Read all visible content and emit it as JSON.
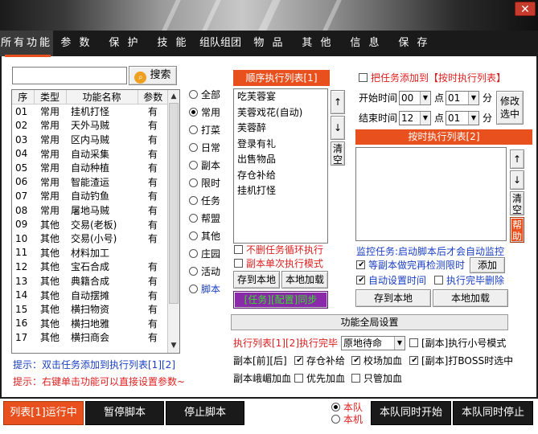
{
  "window": {
    "close_label": "✕"
  },
  "tabs": [
    {
      "label": "所有功能",
      "active": true
    },
    {
      "label": "参 数"
    },
    {
      "label": "保 护"
    },
    {
      "label": "技 能"
    },
    {
      "label": "组队组团"
    },
    {
      "label": "物 品"
    },
    {
      "label": "其 他"
    },
    {
      "label": "信 息"
    },
    {
      "label": "保 存"
    }
  ],
  "search": {
    "value": "",
    "button_label": "搜索",
    "icon": "search-icon"
  },
  "function_table": {
    "headers": [
      "序",
      "类型",
      "功能名称",
      "参数"
    ],
    "rows": [
      [
        "01",
        "常用",
        "挂机打怪",
        "有"
      ],
      [
        "02",
        "常用",
        "天外马贼",
        "有"
      ],
      [
        "03",
        "常用",
        "区内马贼",
        "有"
      ],
      [
        "04",
        "常用",
        "自动采集",
        "有"
      ],
      [
        "05",
        "常用",
        "自动种植",
        "有"
      ],
      [
        "06",
        "常用",
        "智能渣运",
        "有"
      ],
      [
        "07",
        "常用",
        "自动钓鱼",
        "有"
      ],
      [
        "08",
        "常用",
        "屠地马贼",
        "有"
      ],
      [
        "09",
        "其他",
        "交易(老板)",
        "有"
      ],
      [
        "10",
        "其他",
        "交易(小号)",
        "有"
      ],
      [
        "11",
        "其他",
        "材料加工",
        ""
      ],
      [
        "12",
        "其他",
        "宝石合成",
        "有"
      ],
      [
        "13",
        "其他",
        "典籍合成",
        "有"
      ],
      [
        "14",
        "其他",
        "自动摆摊",
        "有"
      ],
      [
        "15",
        "其他",
        "横扫物资",
        "有"
      ],
      [
        "16",
        "其他",
        "横扫地雅",
        "有"
      ],
      [
        "17",
        "其他",
        "横扫商会",
        "有"
      ]
    ]
  },
  "hints": {
    "line1": "提示：双击任务添加到执行列表[1][2]",
    "line2": "提示：右键单击功能可以直接设置参数~"
  },
  "categories": [
    {
      "label": "全部",
      "selected": false
    },
    {
      "label": "常用",
      "selected": true
    },
    {
      "label": "打菜",
      "selected": false
    },
    {
      "label": "日常",
      "selected": false
    },
    {
      "label": "副本",
      "selected": false
    },
    {
      "label": "限时",
      "selected": false
    },
    {
      "label": "任务",
      "selected": false
    },
    {
      "label": "帮盟",
      "selected": false
    },
    {
      "label": "其他",
      "selected": false
    },
    {
      "label": "庄园",
      "selected": false
    },
    {
      "label": "活动",
      "selected": false
    },
    {
      "label": "脚本",
      "selected": false
    }
  ],
  "sequence_list": {
    "title": "顺序执行列表[1]",
    "items": [
      "吃芙蓉宴",
      "芙蓉戏花(自动)",
      "芙蓉醉",
      "登录有礼",
      "出售物品",
      "存仓补给",
      "挂机打怪"
    ],
    "up": "↑",
    "down": "↓",
    "clear": "清空",
    "loop_label": "不删任务循环执行",
    "loop_checked": false,
    "single_label": "副本单次执行模式",
    "single_checked": false,
    "save_local": "存到本地",
    "load_local": "本地加载",
    "sync": "[任务][配置]同步"
  },
  "timed": {
    "add_label": "把任务添加到【按时执行列表】",
    "add_checked": false,
    "start_label": "开始时间",
    "start_hour": "00",
    "start_min": "01",
    "end_label": "结束时间",
    "end_hour": "12",
    "end_min": "01",
    "point": "点",
    "minute": "分",
    "modify_label": "修改选中",
    "list_title": "按时执行列表[2]",
    "up": "↑",
    "down": "↓",
    "clear": "清空",
    "help": "帮助",
    "monitor_text": "监控任务:启动脚本后才会自动监控",
    "wait_label": "等副本做完再检测限时",
    "wait_checked": true,
    "add_btn": "添加",
    "auto_time_label": "自动设置时间",
    "auto_time_checked": true,
    "finish_delete_label": "执行完毕删除",
    "finish_delete_checked": false,
    "save_local": "存到本地",
    "load_local": "本地加载"
  },
  "global": {
    "header": "功能全局设置",
    "exec_label": "执行列表[1][2]执行完毕",
    "exec_option": "原地待命",
    "small_label": "[副本]执行小号模式",
    "small_checked": false,
    "front_back_label": "副本[前][后]",
    "restock_label": "存仓补给",
    "restock_checked": true,
    "arena_label": "校场加血",
    "arena_checked": true,
    "boss_label": "[副本]打BOSS时选中",
    "boss_checked": true,
    "emei_label": "副本峨嵋加血",
    "emei_checked": false,
    "priority_label": "优先加血",
    "priority_checked": false,
    "only_label": "只管加血",
    "only_checked": false
  },
  "bottom": {
    "run_label": "列表[1]运行中",
    "pause_label": "暂停脚本",
    "stop_label": "停止脚本",
    "team_label": "本队",
    "team_selected": true,
    "machine_label": "本机",
    "machine_selected": false,
    "team_start": "本队同时开始",
    "team_stop": "本队同时停止"
  },
  "colors": {
    "accent": "#e8501e",
    "hint_blue": "#1a3fc6",
    "hint_red": "#e02020",
    "sync_purple": "#8a2aa8",
    "sync_text": "#36e02a"
  }
}
